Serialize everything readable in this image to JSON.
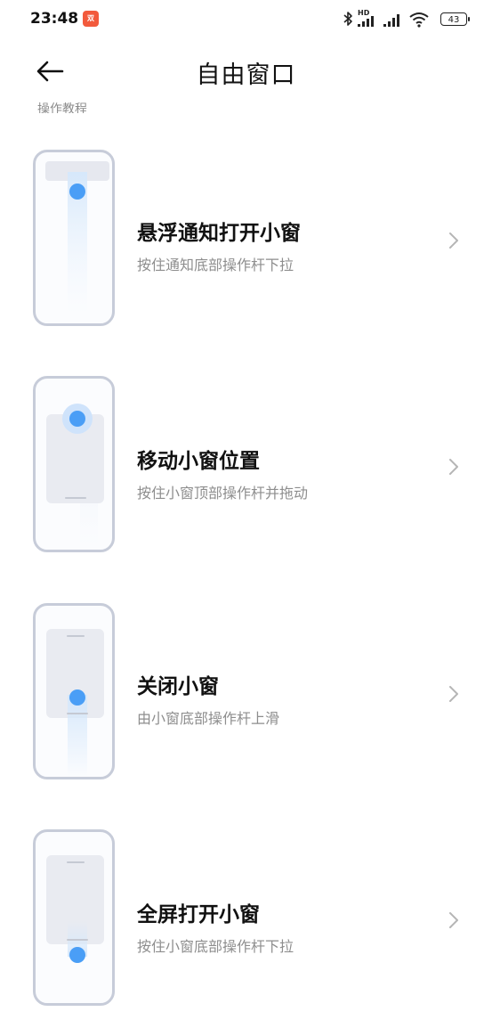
{
  "status_bar": {
    "time": "23:48",
    "app_badge_text": "双11",
    "network_label": "HD",
    "battery": "43"
  },
  "header": {
    "title": "自由窗口"
  },
  "clipped_text": "操作教程",
  "items": [
    {
      "title": "悬浮通知打开小窗",
      "subtitle": "按住通知底部操作杆下拉"
    },
    {
      "title": "移动小窗位置",
      "subtitle": "按住小窗顶部操作杆并拖动"
    },
    {
      "title": "关闭小窗",
      "subtitle": "由小窗底部操作杆上滑"
    },
    {
      "title": "全屏打开小窗",
      "subtitle": "按住小窗底部操作杆下拉"
    }
  ],
  "colors": {
    "accent_dot": "#4a9ef6",
    "phone_outline": "#c7ccd9",
    "subtitle": "#8e8e8e"
  }
}
